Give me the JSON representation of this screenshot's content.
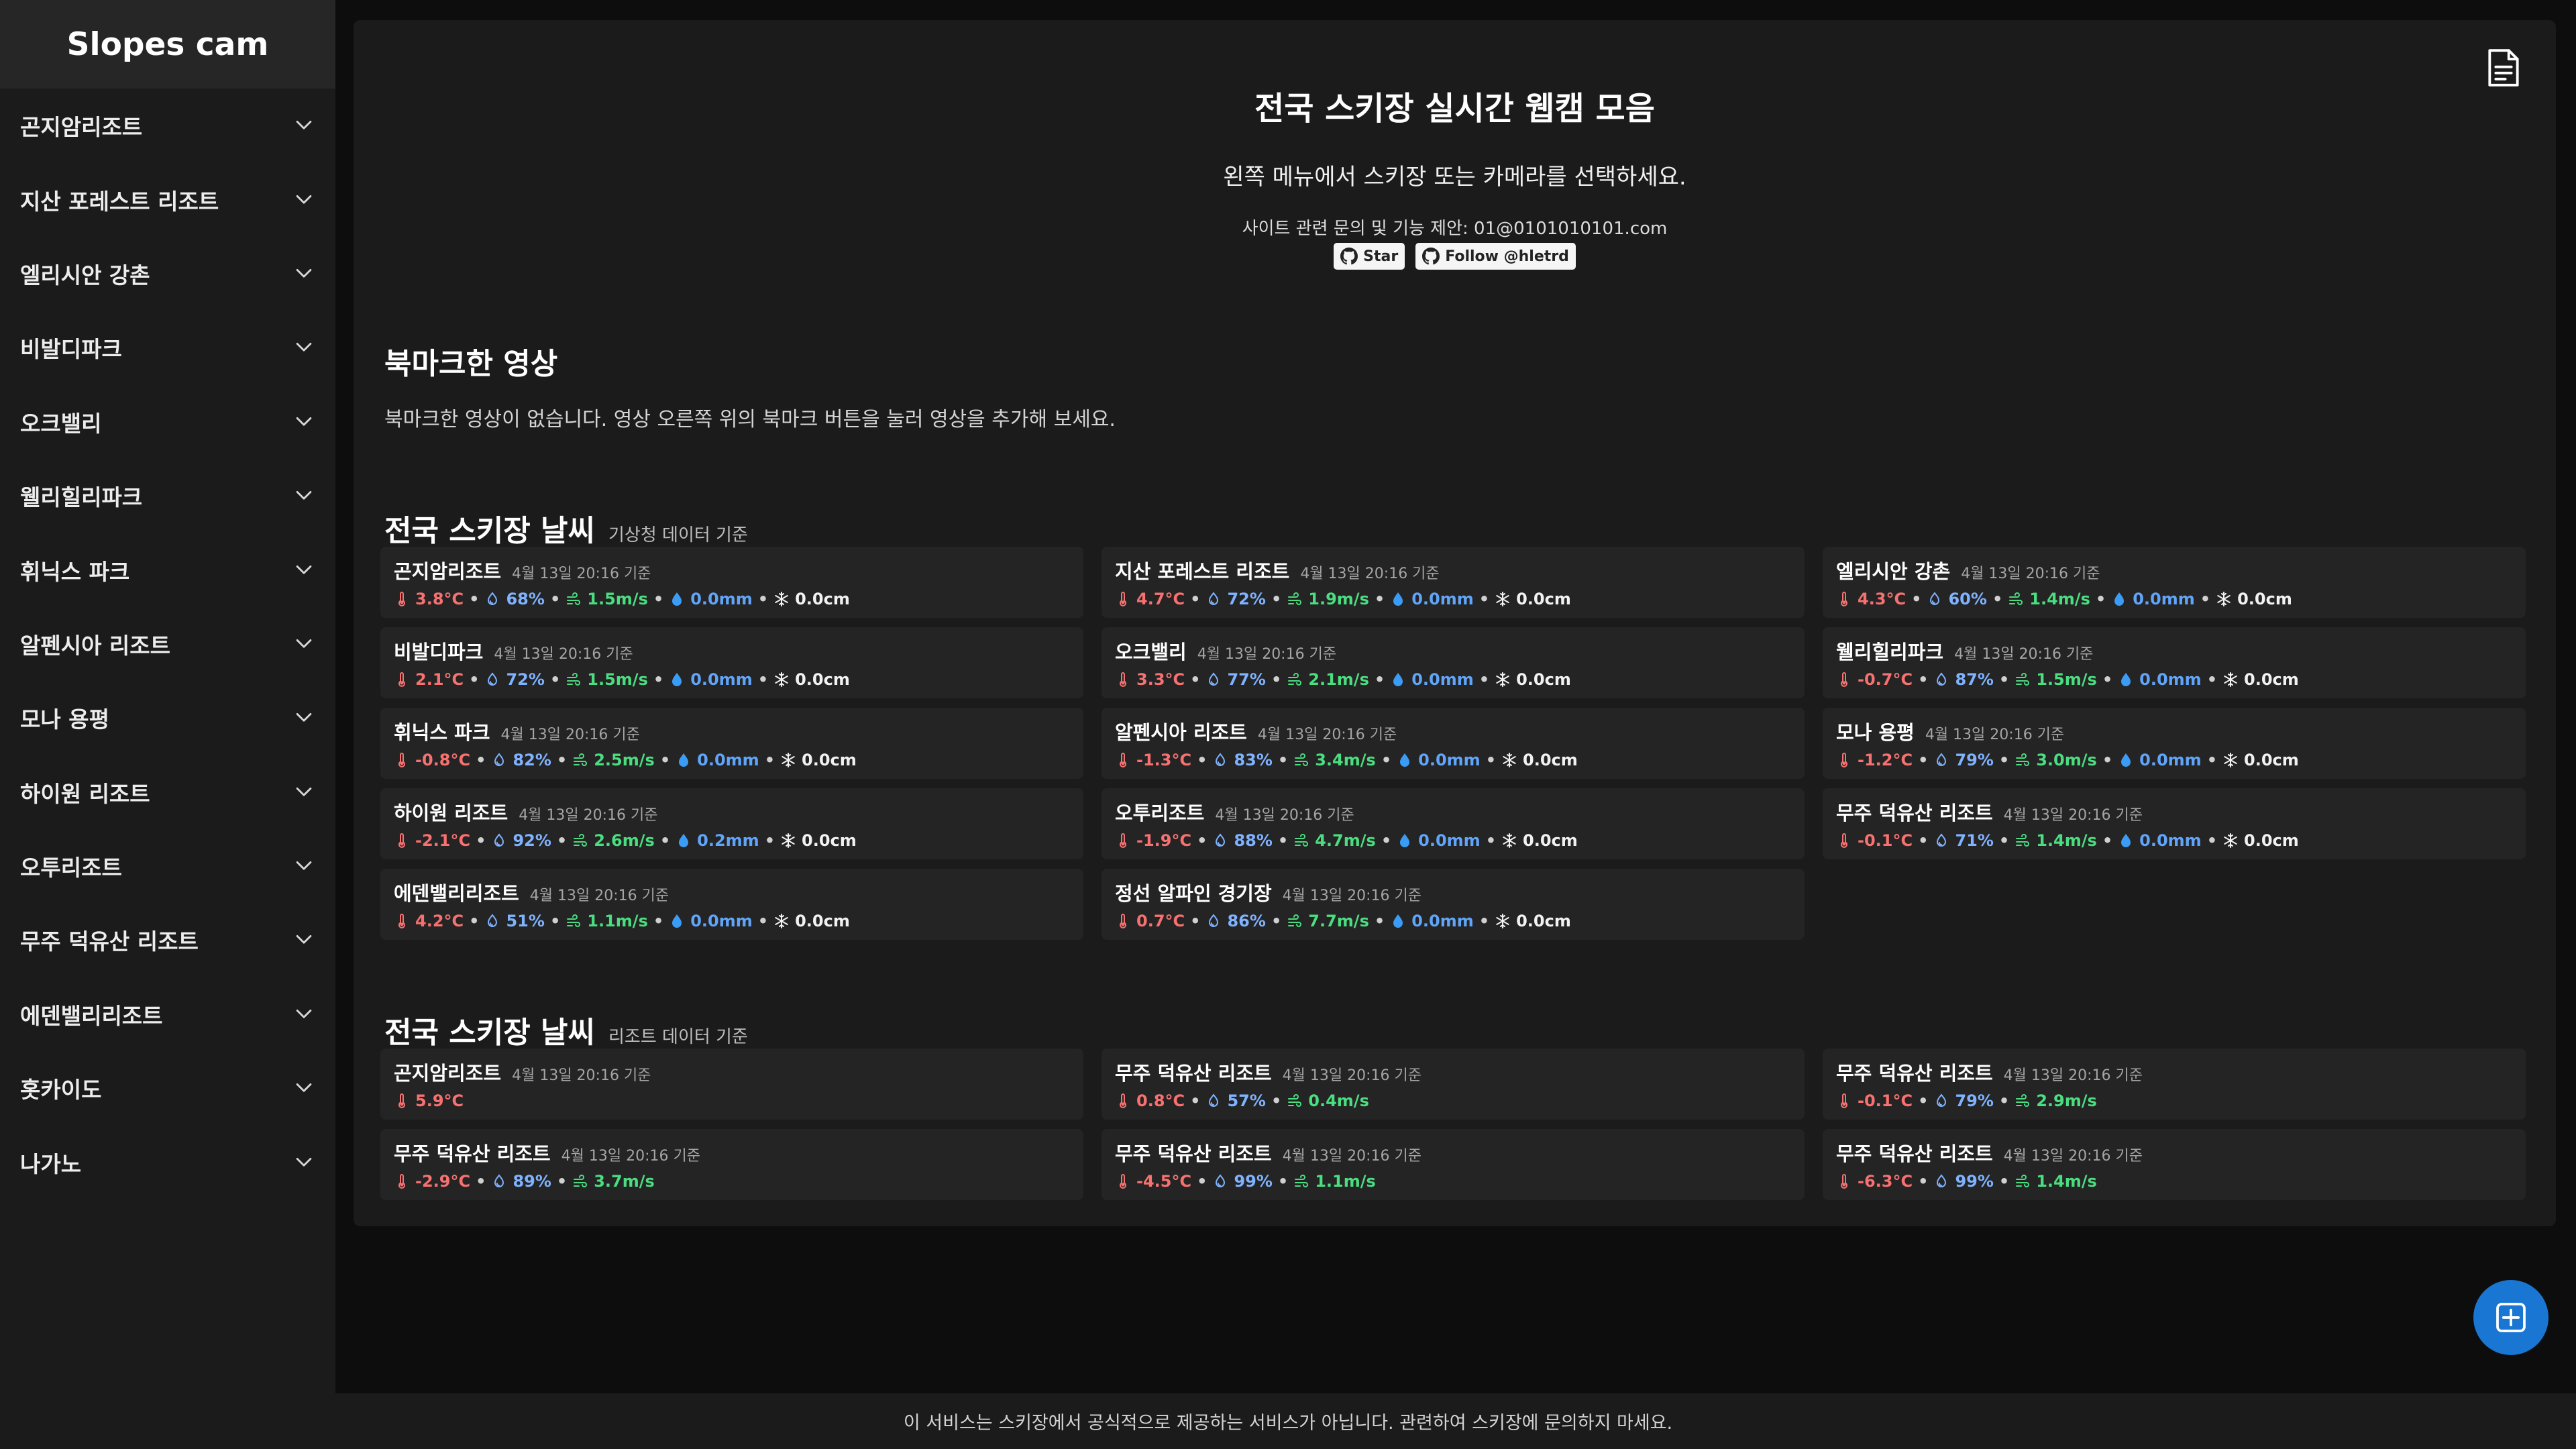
{
  "brand": "Slopes cam",
  "sidebar": {
    "items": [
      {
        "label": "곤지암리조트"
      },
      {
        "label": "지산 포레스트 리조트"
      },
      {
        "label": "엘리시안 강촌"
      },
      {
        "label": "비발디파크"
      },
      {
        "label": "오크밸리"
      },
      {
        "label": "웰리힐리파크"
      },
      {
        "label": "휘닉스 파크"
      },
      {
        "label": "알펜시아 리조트"
      },
      {
        "label": "모나 용평"
      },
      {
        "label": "하이원 리조트"
      },
      {
        "label": "오투리조트"
      },
      {
        "label": "무주 덕유산 리조트"
      },
      {
        "label": "에덴밸리리조트"
      },
      {
        "label": "홋카이도"
      },
      {
        "label": "나가노"
      }
    ]
  },
  "header": {
    "title": "전국 스키장 실시간 웹캠 모음",
    "subtitle": "왼쪽 메뉴에서 스키장 또는 카메라를 선택하세요.",
    "contact": "사이트 관련 문의 및 기능 제안: 01@0101010101.com",
    "star_label": "Star",
    "follow_label": "Follow @hletrd"
  },
  "bookmarks": {
    "heading": "북마크한 영상",
    "empty_text": "북마크한 영상이 없습니다. 영상 오른쪽 위의 북마크 버튼을 눌러 영상을 추가해 보세요."
  },
  "weather_kma": {
    "heading": "전국 스키장 날씨",
    "source": "기상청 데이터 기준",
    "cards": [
      {
        "name": "곤지암리조트",
        "time": "4월 13일 20:16 기준",
        "temp": "3.8°C",
        "humidity": "68%",
        "wind": "1.5m/s",
        "rain": "0.0mm",
        "snow": "0.0cm"
      },
      {
        "name": "지산 포레스트 리조트",
        "time": "4월 13일 20:16 기준",
        "temp": "4.7°C",
        "humidity": "72%",
        "wind": "1.9m/s",
        "rain": "0.0mm",
        "snow": "0.0cm"
      },
      {
        "name": "엘리시안 강촌",
        "time": "4월 13일 20:16 기준",
        "temp": "4.3°C",
        "humidity": "60%",
        "wind": "1.4m/s",
        "rain": "0.0mm",
        "snow": "0.0cm"
      },
      {
        "name": "비발디파크",
        "time": "4월 13일 20:16 기준",
        "temp": "2.1°C",
        "humidity": "72%",
        "wind": "1.5m/s",
        "rain": "0.0mm",
        "snow": "0.0cm"
      },
      {
        "name": "오크밸리",
        "time": "4월 13일 20:16 기준",
        "temp": "3.3°C",
        "humidity": "77%",
        "wind": "2.1m/s",
        "rain": "0.0mm",
        "snow": "0.0cm"
      },
      {
        "name": "웰리힐리파크",
        "time": "4월 13일 20:16 기준",
        "temp": "-0.7°C",
        "humidity": "87%",
        "wind": "1.5m/s",
        "rain": "0.0mm",
        "snow": "0.0cm"
      },
      {
        "name": "휘닉스 파크",
        "time": "4월 13일 20:16 기준",
        "temp": "-0.8°C",
        "humidity": "82%",
        "wind": "2.5m/s",
        "rain": "0.0mm",
        "snow": "0.0cm"
      },
      {
        "name": "알펜시아 리조트",
        "time": "4월 13일 20:16 기준",
        "temp": "-1.3°C",
        "humidity": "83%",
        "wind": "3.4m/s",
        "rain": "0.0mm",
        "snow": "0.0cm"
      },
      {
        "name": "모나 용평",
        "time": "4월 13일 20:16 기준",
        "temp": "-1.2°C",
        "humidity": "79%",
        "wind": "3.0m/s",
        "rain": "0.0mm",
        "snow": "0.0cm"
      },
      {
        "name": "하이원 리조트",
        "time": "4월 13일 20:16 기준",
        "temp": "-2.1°C",
        "humidity": "92%",
        "wind": "2.6m/s",
        "rain": "0.2mm",
        "snow": "0.0cm"
      },
      {
        "name": "오투리조트",
        "time": "4월 13일 20:16 기준",
        "temp": "-1.9°C",
        "humidity": "88%",
        "wind": "4.7m/s",
        "rain": "0.0mm",
        "snow": "0.0cm"
      },
      {
        "name": "무주 덕유산 리조트",
        "time": "4월 13일 20:16 기준",
        "temp": "-0.1°C",
        "humidity": "71%",
        "wind": "1.4m/s",
        "rain": "0.0mm",
        "snow": "0.0cm"
      },
      {
        "name": "에덴밸리리조트",
        "time": "4월 13일 20:16 기준",
        "temp": "4.2°C",
        "humidity": "51%",
        "wind": "1.1m/s",
        "rain": "0.0mm",
        "snow": "0.0cm"
      },
      {
        "name": "정선 알파인 경기장",
        "time": "4월 13일 20:16 기준",
        "temp": "0.7°C",
        "humidity": "86%",
        "wind": "7.7m/s",
        "rain": "0.0mm",
        "snow": "0.0cm"
      }
    ]
  },
  "weather_resort": {
    "heading": "전국 스키장 날씨",
    "source": "리조트 데이터 기준",
    "cards": [
      {
        "name": "곤지암리조트",
        "time": "4월 13일 20:16 기준",
        "temp": "5.9°C"
      },
      {
        "name": "무주 덕유산 리조트",
        "time": "4월 13일 20:16 기준",
        "temp": "0.8°C",
        "humidity": "57%",
        "wind": "0.4m/s"
      },
      {
        "name": "무주 덕유산 리조트",
        "time": "4월 13일 20:16 기준",
        "temp": "-0.1°C",
        "humidity": "79%",
        "wind": "2.9m/s"
      },
      {
        "name": "무주 덕유산 리조트",
        "time": "4월 13일 20:16 기준",
        "temp": "-2.9°C",
        "humidity": "89%",
        "wind": "3.7m/s"
      },
      {
        "name": "무주 덕유산 리조트",
        "time": "4월 13일 20:16 기준",
        "temp": "-4.5°C",
        "humidity": "99%",
        "wind": "1.1m/s"
      },
      {
        "name": "무주 덕유산 리조트",
        "time": "4월 13일 20:16 기준",
        "temp": "-6.3°C",
        "humidity": "99%",
        "wind": "1.4m/s"
      }
    ]
  },
  "footer": {
    "text": "이 서비스는 스키장에서 공식적으로 제공하는 서비스가 아닙니다. 관련하여 스키장에 문의하지 마세요."
  },
  "icons": {
    "chevron": "chevron-down-icon",
    "document": "document-icon",
    "github": "github-icon",
    "temp": "thermometer-icon",
    "humidity": "humidity-icon",
    "wind": "wind-icon",
    "rain": "raindrop-icon",
    "snow": "snowflake-icon",
    "add": "add-icon"
  },
  "colors": {
    "accent": "#1976d2",
    "temp": "#f87171",
    "humidity": "#7fb2ff",
    "wind": "#4ade80",
    "rain": "#60a5fa"
  }
}
